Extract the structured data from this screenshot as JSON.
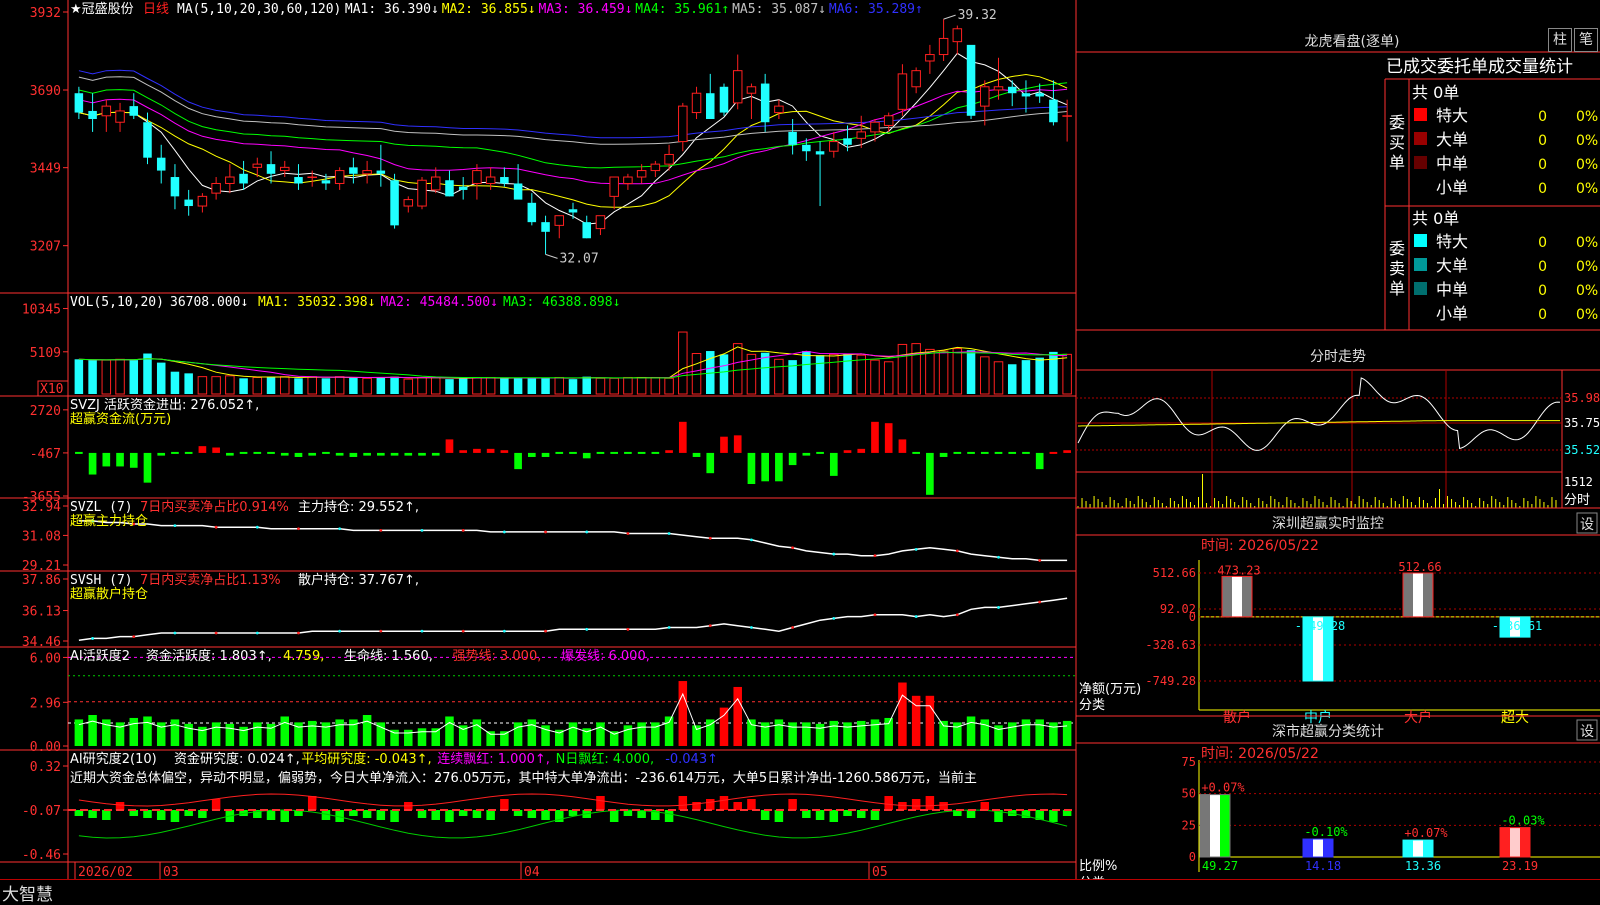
{
  "brand": "大智慧",
  "stock": {
    "name": "★冠盛股份",
    "period": "日线",
    "ma_label": "MA(5,10,20,30,60,120)",
    "ma": [
      {
        "label": "MA1:",
        "value": "36.390↓",
        "color": "#ffffff"
      },
      {
        "label": "MA2:",
        "value": "36.855↓",
        "color": "#ffff00"
      },
      {
        "label": "MA3:",
        "value": "36.459↓",
        "color": "#ff00ff"
      },
      {
        "label": "MA4:",
        "value": "35.961↑",
        "color": "#00ff00"
      },
      {
        "label": "MA5:",
        "value": "35.087↓",
        "color": "#c0c0c0"
      },
      {
        "label": "MA6:",
        "value": "35.289↑",
        "color": "#3030ff"
      }
    ],
    "high_mark": "39.32",
    "low_mark": "32.07"
  },
  "colors": {
    "up": "#ff2020",
    "down": "#20ffff",
    "axis": "#ff3030",
    "grid": "#b00000"
  },
  "date_axis": [
    "2026/02",
    "03",
    "04",
    "05"
  ],
  "chart_data": [
    {
      "type": "candlestick",
      "name": "price",
      "ylim": [
        3085,
        3932
      ],
      "y_ticks": [
        "3932",
        "3690",
        "3449",
        "3207"
      ],
      "series": [
        {
          "name": "MA1",
          "color": "#ffffff"
        },
        {
          "name": "MA2",
          "color": "#ffff00"
        },
        {
          "name": "MA3",
          "color": "#ff00ff"
        },
        {
          "name": "MA4",
          "color": "#00ff00"
        },
        {
          "name": "MA5",
          "color": "#c0c0c0"
        },
        {
          "name": "MA6",
          "color": "#3030ff"
        }
      ],
      "ohlc": [
        [
          3680,
          3700,
          3600,
          3620
        ],
        [
          3625,
          3680,
          3560,
          3600
        ],
        [
          3610,
          3660,
          3560,
          3640
        ],
        [
          3590,
          3650,
          3560,
          3625
        ],
        [
          3640,
          3680,
          3600,
          3610
        ],
        [
          3590,
          3620,
          3460,
          3480
        ],
        [
          3480,
          3520,
          3400,
          3440
        ],
        [
          3420,
          3460,
          3320,
          3360
        ],
        [
          3350,
          3380,
          3300,
          3330
        ],
        [
          3330,
          3370,
          3310,
          3360
        ],
        [
          3370,
          3420,
          3350,
          3400
        ],
        [
          3400,
          3460,
          3370,
          3420
        ],
        [
          3430,
          3470,
          3380,
          3400
        ],
        [
          3450,
          3480,
          3420,
          3460
        ],
        [
          3460,
          3500,
          3400,
          3430
        ],
        [
          3440,
          3470,
          3420,
          3450
        ],
        [
          3420,
          3460,
          3380,
          3400
        ],
        [
          3420,
          3440,
          3390,
          3420
        ],
        [
          3410,
          3430,
          3380,
          3400
        ],
        [
          3400,
          3450,
          3380,
          3440
        ],
        [
          3450,
          3480,
          3400,
          3430
        ],
        [
          3430,
          3470,
          3400,
          3440
        ],
        [
          3440,
          3520,
          3390,
          3430
        ],
        [
          3410,
          3430,
          3260,
          3270
        ],
        [
          3330,
          3360,
          3310,
          3350
        ],
        [
          3330,
          3420,
          3320,
          3410
        ],
        [
          3380,
          3450,
          3370,
          3420
        ],
        [
          3410,
          3440,
          3360,
          3360
        ],
        [
          3390,
          3420,
          3350,
          3380
        ],
        [
          3400,
          3460,
          3350,
          3440
        ],
        [
          3400,
          3450,
          3380,
          3420
        ],
        [
          3420,
          3450,
          3390,
          3400
        ],
        [
          3400,
          3460,
          3380,
          3350
        ],
        [
          3340,
          3370,
          3270,
          3280
        ],
        [
          3280,
          3300,
          3180,
          3250
        ],
        [
          3270,
          3300,
          3230,
          3300
        ],
        [
          3320,
          3340,
          3290,
          3310
        ],
        [
          3280,
          3300,
          3230,
          3230
        ],
        [
          3260,
          3290,
          3240,
          3300
        ],
        [
          3360,
          3380,
          3320,
          3420
        ],
        [
          3400,
          3430,
          3380,
          3420
        ],
        [
          3420,
          3460,
          3400,
          3440
        ],
        [
          3440,
          3470,
          3420,
          3460
        ],
        [
          3460,
          3520,
          3440,
          3490
        ],
        [
          3530,
          3650,
          3500,
          3640
        ],
        [
          3620,
          3700,
          3600,
          3680
        ],
        [
          3680,
          3740,
          3640,
          3600
        ],
        [
          3700,
          3710,
          3610,
          3620
        ],
        [
          3650,
          3800,
          3630,
          3750
        ],
        [
          3680,
          3710,
          3600,
          3700
        ],
        [
          3710,
          3740,
          3560,
          3590
        ],
        [
          3620,
          3660,
          3600,
          3640
        ],
        [
          3560,
          3600,
          3490,
          3520
        ],
        [
          3520,
          3540,
          3470,
          3500
        ],
        [
          3500,
          3530,
          3330,
          3490
        ],
        [
          3500,
          3560,
          3480,
          3530
        ],
        [
          3540,
          3580,
          3500,
          3520
        ],
        [
          3540,
          3610,
          3510,
          3560
        ],
        [
          3560,
          3600,
          3530,
          3590
        ],
        [
          3580,
          3620,
          3560,
          3610
        ],
        [
          3630,
          3770,
          3610,
          3740
        ],
        [
          3700,
          3760,
          3680,
          3750
        ],
        [
          3780,
          3830,
          3740,
          3800
        ],
        [
          3800,
          3910,
          3780,
          3850
        ],
        [
          3840,
          3890,
          3800,
          3880
        ],
        [
          3830,
          3790,
          3600,
          3610
        ],
        [
          3640,
          3720,
          3580,
          3700
        ],
        [
          3690,
          3790,
          3660,
          3700
        ],
        [
          3700,
          3720,
          3640,
          3680
        ],
        [
          3680,
          3720,
          3620,
          3670
        ],
        [
          3680,
          3710,
          3650,
          3670
        ],
        [
          3660,
          3720,
          3580,
          3590
        ],
        [
          3610,
          3660,
          3530,
          3610
        ]
      ]
    },
    {
      "type": "bar",
      "name": "VOL",
      "label": "VOL(5,10,20)",
      "current": "36708.000↓",
      "ma": [
        {
          "label": "MA1:",
          "value": "35032.398↓",
          "color": "#ffff00"
        },
        {
          "label": "MA2:",
          "value": "45484.500↓",
          "color": "#ff00ff"
        },
        {
          "label": "MA3:",
          "value": "46388.898↓",
          "color": "#00ff00"
        }
      ],
      "y_ticks": [
        "10345",
        "5109"
      ],
      "unit": "X10",
      "ylim": [
        0,
        11500
      ],
      "values": [
        4200,
        4100,
        4100,
        4200,
        4100,
        4900,
        3800,
        2700,
        2500,
        2100,
        2100,
        2200,
        1900,
        2000,
        2100,
        2100,
        1900,
        2100,
        1900,
        2100,
        2000,
        1900,
        2000,
        2100,
        1800,
        2000,
        2000,
        1800,
        1900,
        2000,
        2000,
        1900,
        1900,
        1900,
        2000,
        2000,
        1800,
        2100,
        1900,
        1900,
        2000,
        2000,
        2000,
        1900,
        7500,
        4900,
        5200,
        4800,
        6100,
        4800,
        5000,
        4200,
        4100,
        5200,
        4700,
        4800,
        4900,
        4700,
        4100,
        3900,
        6000,
        6100,
        5400,
        5200,
        5500,
        5300,
        4500,
        3900,
        3600,
        4100,
        4400,
        5100,
        4800
      ]
    },
    {
      "type": "bar",
      "name": "SVZJ",
      "label": "SVZJ  活跃资金进出: 276.052↑,",
      "sub": "超赢资金流(万元)",
      "y_ticks": [
        "2720",
        "-467",
        "-3655"
      ],
      "ylim": [
        -3655,
        3300
      ],
      "values": [
        -100,
        -1600,
        -1000,
        -1000,
        -1100,
        -2200,
        -200,
        -100,
        -100,
        500,
        400,
        -200,
        -100,
        -100,
        -100,
        -200,
        -300,
        -200,
        -100,
        -200,
        -300,
        -200,
        -200,
        -200,
        -200,
        -200,
        -200,
        1000,
        200,
        300,
        300,
        200,
        -1200,
        -300,
        -300,
        -100,
        -100,
        -400,
        -100,
        -100,
        -100,
        -100,
        -100,
        200,
        2300,
        -300,
        -1500,
        1200,
        1300,
        -2300,
        -2100,
        -2100,
        -900,
        -200,
        -100,
        -1700,
        200,
        300,
        2300,
        2200,
        1000,
        -100,
        -3100,
        -300,
        -100,
        -100,
        -100,
        -100,
        -100,
        -100,
        -1200,
        100,
        200
      ]
    },
    {
      "type": "line",
      "name": "SVZL",
      "label": "SVZL (7)",
      "stat": "7日内买卖净占比0.914%",
      "hold": "主力持仓: 29.552↑,",
      "sub": "超赢主力持仓",
      "y_ticks": [
        "32.94",
        "31.08",
        "29.21"
      ],
      "ylim": [
        29.21,
        32.94
      ],
      "values": [
        32.0,
        32.0,
        31.9,
        31.9,
        31.8,
        31.8,
        31.7,
        31.7,
        31.7,
        31.7,
        31.6,
        31.6,
        31.6,
        31.6,
        31.5,
        31.5,
        31.5,
        31.5,
        31.5,
        31.5,
        31.4,
        31.4,
        31.4,
        31.4,
        31.4,
        31.4,
        31.4,
        31.4,
        31.4,
        31.4,
        31.3,
        31.3,
        31.3,
        31.3,
        31.3,
        31.3,
        31.3,
        31.3,
        31.3,
        31.3,
        31.2,
        31.2,
        31.2,
        31.2,
        31.1,
        31.0,
        30.9,
        30.9,
        30.9,
        30.8,
        30.6,
        30.4,
        30.3,
        30.1,
        30.0,
        29.9,
        29.9,
        29.8,
        29.8,
        29.9,
        30.1,
        30.2,
        30.3,
        30.2,
        30.1,
        29.9,
        29.8,
        29.7,
        29.6,
        29.6,
        29.5,
        29.5,
        29.5
      ]
    },
    {
      "type": "line",
      "name": "SVSH",
      "label": "SVSH (7)",
      "stat": "7日内买卖净占比1.13%",
      "hold": "散户持仓: 37.767↑,",
      "sub": "超赢散户持仓",
      "y_ticks": [
        "37.86",
        "36.13",
        "34.46"
      ],
      "ylim": [
        34.46,
        37.86
      ],
      "values": [
        34.5,
        34.6,
        34.6,
        34.7,
        34.7,
        34.8,
        34.9,
        34.9,
        34.9,
        34.9,
        34.9,
        34.9,
        34.9,
        34.9,
        34.9,
        34.9,
        34.9,
        35.0,
        35.0,
        35.0,
        35.0,
        35.0,
        35.0,
        35.0,
        35.0,
        35.0,
        35.0,
        35.0,
        35.0,
        35.0,
        35.0,
        35.0,
        35.0,
        35.0,
        35.0,
        35.1,
        35.1,
        35.1,
        35.1,
        35.1,
        35.1,
        35.1,
        35.1,
        35.2,
        35.2,
        35.2,
        35.3,
        35.4,
        35.3,
        35.2,
        35.1,
        35.0,
        35.2,
        35.4,
        35.6,
        35.7,
        35.8,
        35.8,
        35.9,
        35.9,
        35.9,
        35.8,
        35.9,
        35.8,
        35.9,
        36.2,
        36.3,
        36.3,
        36.4,
        36.5,
        36.6,
        36.7,
        36.8
      ]
    },
    {
      "type": "bar",
      "name": "AI活跃度2",
      "label": "AI活跃度2",
      "fields": [
        {
          "text": "资金活跃度: 1.803↑,",
          "color": "#ffffff"
        },
        {
          "text": "4.759,",
          "color": "#ffff00"
        },
        {
          "text": "生命线: 1.560,",
          "color": "#ffffff"
        },
        {
          "text": "强势线: 3.000,",
          "color": "#ff3030"
        },
        {
          "text": "爆发线: 6.000,",
          "color": "#ff00ff"
        }
      ],
      "y_ticks": [
        "6.00",
        "2.96",
        "0.00"
      ],
      "ylim": [
        0,
        6.3
      ],
      "values": [
        1.8,
        2.1,
        1.8,
        1.6,
        1.9,
        2.0,
        1.6,
        1.8,
        1.5,
        1.3,
        1.6,
        1.5,
        1.3,
        1.6,
        1.5,
        2.0,
        1.6,
        1.7,
        1.6,
        1.8,
        1.8,
        2.1,
        1.6,
        1.1,
        1.1,
        1.2,
        1.2,
        2.0,
        1.4,
        1.8,
        1.0,
        1.0,
        1.6,
        1.8,
        1.4,
        1.1,
        1.6,
        1.2,
        1.6,
        1.0,
        1.4,
        1.6,
        1.6,
        2.0,
        4.4,
        1.4,
        1.8,
        2.6,
        4.0,
        1.8,
        1.6,
        1.8,
        1.6,
        1.6,
        1.5,
        1.7,
        1.6,
        1.7,
        1.8,
        1.9,
        4.3,
        3.4,
        3.4,
        1.7,
        1.6,
        2.0,
        1.8,
        1.4,
        1.6,
        1.8,
        1.8,
        1.6,
        1.7
      ]
    },
    {
      "type": "bar",
      "name": "AI研究度2",
      "label": "AI研究度2(10)",
      "fields": [
        {
          "text": "资金研究度: 0.024↑,",
          "color": "#ffffff"
        },
        {
          "text": "平均研究度: -0.043↑,",
          "color": "#ffff00"
        },
        {
          "text": "连续飘红: 1.000↑,",
          "color": "#ff00ff"
        },
        {
          "text": "N日飘红: 4.000,",
          "color": "#00ff00"
        },
        {
          "text": "-0.043↑",
          "color": "#3030ff"
        }
      ],
      "note": "近期大资金总体偏空，异动不明显，偏弱势，今日大单净流入：276.05万元，其中特大单净流出：-236.614万元，大单5日累计净出-1260.586万元，当前主",
      "y_ticks": [
        "0.32",
        "-0.07",
        "-0.46"
      ],
      "ylim": [
        -0.46,
        0.32
      ]
    }
  ],
  "panel_lhb": {
    "title": "龙虎看盘(逐单)",
    "btn1": "柱",
    "btn2": "笔",
    "header": "已成交委托单成交量统计",
    "buy": {
      "side": "委买单",
      "total": "共 0单",
      "rows": [
        {
          "label": "特大",
          "value": "0",
          "pct": "0%",
          "color": "#ff0000"
        },
        {
          "label": "大单",
          "value": "0",
          "pct": "0%",
          "color": "#990000"
        },
        {
          "label": "中单",
          "value": "0",
          "pct": "0%",
          "color": "#660000"
        },
        {
          "label": "小单",
          "value": "0",
          "pct": "0%",
          "color": "#000000"
        }
      ]
    },
    "sell": {
      "side": "委卖单",
      "total": "共 0单",
      "rows": [
        {
          "label": "特大",
          "value": "0",
          "pct": "0%",
          "color": "#00ffff"
        },
        {
          "label": "大单",
          "value": "0",
          "pct": "0%",
          "color": "#009999"
        },
        {
          "label": "中单",
          "value": "0",
          "pct": "0%",
          "color": "#006f6f"
        },
        {
          "label": "小单",
          "value": "0",
          "pct": "0%",
          "color": "#000000"
        }
      ]
    }
  },
  "panel_intraday": {
    "title": "分时走势",
    "y_ticks": [
      "35.98",
      "35.75",
      "35.52"
    ],
    "vol_top": "1512",
    "vol_label": "分时"
  },
  "panel_sz": {
    "title": "深圳超赢实时监控",
    "btn": "设",
    "time": "时间: 2026/05/22",
    "y_ticks": [
      "512.66",
      "92.02",
      "0",
      "-328.63",
      "-749.28"
    ],
    "ylabel": "净额(万元)",
    "xlabel": "分类",
    "bars": [
      {
        "cat": "散户",
        "value": 473.23,
        "label": "473.23"
      },
      {
        "cat": "中户",
        "value": -749.28,
        "label": "-749.28"
      },
      {
        "cat": "大户",
        "value": 512.66,
        "label": "512.66"
      },
      {
        "cat": "超大",
        "value": -236.61,
        "label": "-236.61"
      }
    ]
  },
  "panel_cat": {
    "title": "深市超赢分类统计",
    "btn": "设",
    "time": "时间: 2026/05/22",
    "y_ticks": [
      "75",
      "50",
      "25",
      "0"
    ],
    "ylabel": "比例%",
    "xlabel": "分类",
    "bars": [
      {
        "cat": "散户",
        "value": 49.27,
        "label": "49.27",
        "delta": "+0.07%"
      },
      {
        "cat": "中户",
        "value": 14.18,
        "label": "14.18",
        "delta": "-0.10%"
      },
      {
        "cat": "大户",
        "value": 13.36,
        "label": "13.36",
        "delta": "+0.07%"
      },
      {
        "cat": "超大",
        "value": 23.19,
        "label": "23.19",
        "delta": "-0.03%"
      }
    ]
  }
}
